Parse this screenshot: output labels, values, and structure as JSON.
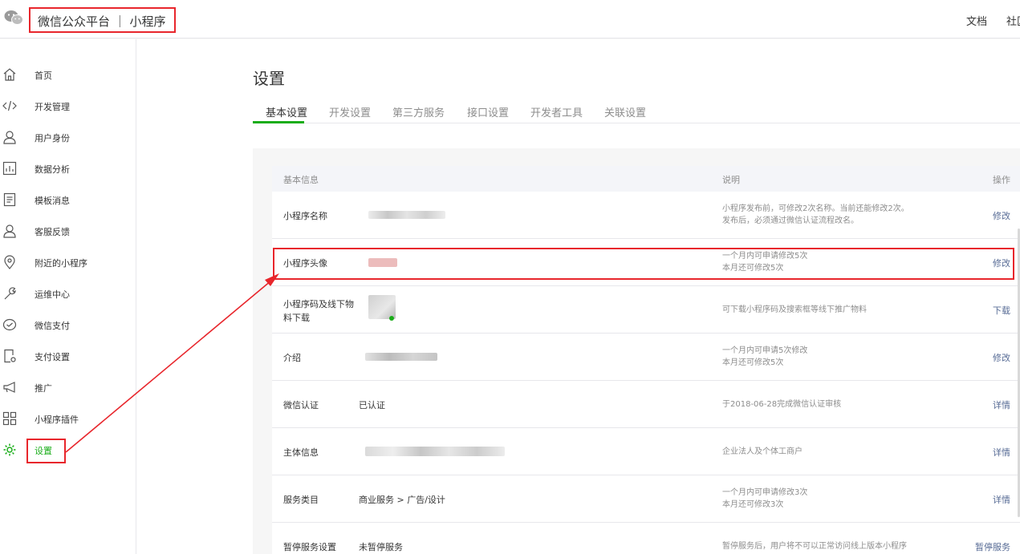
{
  "header": {
    "logo_icon": "wechat-logo-icon",
    "brand": "微信公众平台 ｜ 小程序",
    "links": [
      "文档",
      "社区"
    ]
  },
  "sidebar": {
    "items": [
      {
        "label": "首页",
        "icon": "home-icon"
      },
      {
        "label": "开发管理",
        "icon": "code-icon"
      },
      {
        "label": "用户身份",
        "icon": "user-icon"
      },
      {
        "label": "数据分析",
        "icon": "chart-icon"
      },
      {
        "label": "模板消息",
        "icon": "message-icon"
      },
      {
        "label": "客服反馈",
        "icon": "service-icon"
      },
      {
        "label": "附近的小程序",
        "icon": "location-icon"
      },
      {
        "label": "运维中心",
        "icon": "wrench-icon"
      },
      {
        "label": "微信支付",
        "icon": "pay-icon"
      },
      {
        "label": "支付设置",
        "icon": "pay-settings-icon"
      },
      {
        "label": "推广",
        "icon": "megaphone-icon"
      },
      {
        "label": "小程序插件",
        "icon": "plugin-icon"
      },
      {
        "label": "设置",
        "icon": "gear-icon",
        "active": true
      }
    ]
  },
  "main": {
    "title": "设置",
    "tabs": [
      "基本设置",
      "开发设置",
      "第三方服务",
      "接口设置",
      "开发者工具",
      "关联设置"
    ],
    "active_tab": "基本设置",
    "table": {
      "headers": {
        "info": "基本信息",
        "desc": "说明",
        "action": "操作"
      },
      "rows": [
        {
          "label": "小程序名称",
          "value": "",
          "desc1": "小程序发布前，可修改2次名称。当前还能修改2次。",
          "desc2": "发布后，必须通过微信认证流程改名。",
          "action": "修改"
        },
        {
          "label": "小程序头像",
          "value": "",
          "desc1": "一个月内可申请修改5次",
          "desc2": "本月还可修改5次",
          "action": "修改"
        },
        {
          "label": "小程序码及线下物料下载",
          "value": "",
          "desc1": "可下载小程序码及搜索框等线下推广物料",
          "desc2": "",
          "action": "下载"
        },
        {
          "label": "介绍",
          "value": "",
          "desc1": "一个月内可申请5次修改",
          "desc2": "本月还可修改5次",
          "action": "修改"
        },
        {
          "label": "微信认证",
          "value": "已认证",
          "desc1": "于2018-06-28完成微信认证审核",
          "desc2": "",
          "action": "详情"
        },
        {
          "label": "主体信息",
          "value": "",
          "desc1": "企业法人及个体工商户",
          "desc2": "",
          "action": "详情"
        },
        {
          "label": "服务类目",
          "value": "商业服务 > 广告/设计",
          "desc1": "一个月内可申请修改3次",
          "desc2": "本月还可修改3次",
          "action": "详情"
        },
        {
          "label": "暂停服务设置",
          "value": "未暂停服务",
          "desc1": "暂停服务后，用户将不可以正常访问线上版本小程序",
          "desc2": "",
          "action": "暂停服务"
        }
      ]
    }
  },
  "colors": {
    "accent": "#1aad19",
    "link": "#576b95",
    "annotation": "#e8262c"
  }
}
